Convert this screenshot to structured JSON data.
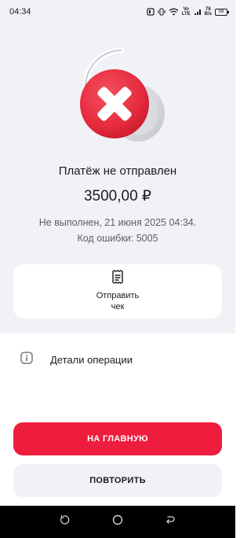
{
  "status_bar": {
    "time": "04:34",
    "net_top": "Vo",
    "net_bottom": "LTE",
    "speed_top": "78",
    "speed_bottom": "B/s",
    "battery": "58"
  },
  "result": {
    "title": "Платёж не отправлен",
    "amount": "3500,00 ₽",
    "status_line": "Не выполнен, 21 июня 2025 04:34.",
    "error_line": "Код ошибки: 5005"
  },
  "receipt_action": {
    "label": "Отправить чек",
    "icon": "receipt-icon"
  },
  "details": {
    "label": "Детали операции",
    "icon": "info-icon"
  },
  "buttons": {
    "home_label": "НА ГЛАВНУЮ",
    "retry_label": "ПОВТОРИТЬ"
  },
  "colors": {
    "accent": "#ef1d3d",
    "background_top": "#f1f2f5"
  }
}
